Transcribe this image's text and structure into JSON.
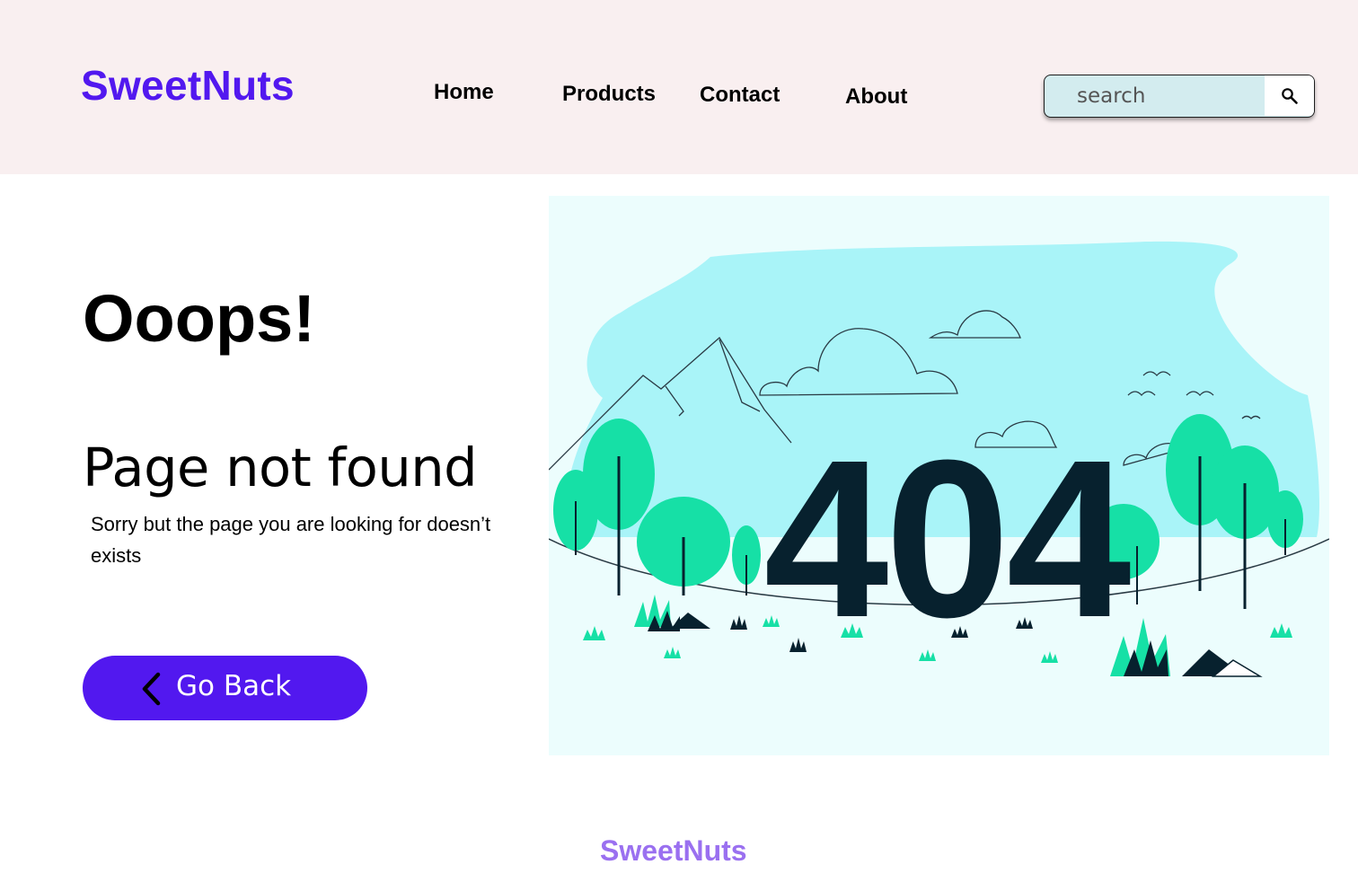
{
  "header": {
    "brand": "SweetNuts",
    "nav": [
      {
        "label": "Home"
      },
      {
        "label": "Products"
      },
      {
        "label": "Contact"
      },
      {
        "label": "About"
      }
    ],
    "search": {
      "placeholder": "search",
      "value": "",
      "icon": "search-icon"
    }
  },
  "main": {
    "headline": "Ooops!",
    "subheadline": "Page not found",
    "message": "Sorry but the page you are looking for doesn’t exists",
    "back_button": {
      "label": "Go Back",
      "icon": "chevron-left-icon"
    },
    "illustration": {
      "code": "404",
      "icon": "404-landscape-illustration"
    }
  },
  "footer": {
    "brand": "SweetNuts"
  },
  "colors": {
    "brand": "#5218ef",
    "header_bg": "#f9eff0",
    "footer_brand": "#9a70f0",
    "illustration_bg": "#ecfdfd",
    "sky": "#a9f4f8",
    "tree": "#16e0a6",
    "ink": "#07212e"
  }
}
